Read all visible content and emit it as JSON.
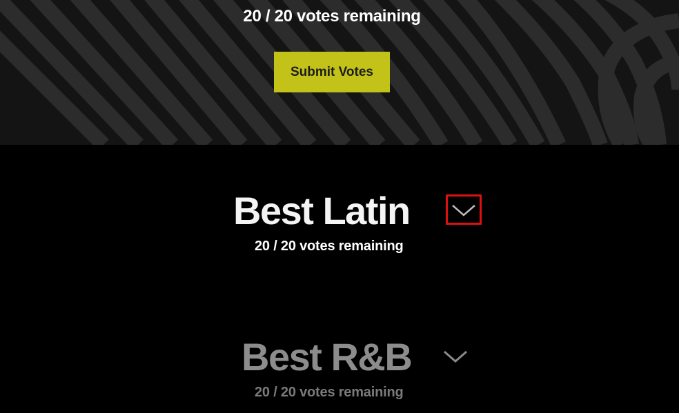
{
  "header": {
    "votes_remaining": "20 / 20 votes remaining",
    "submit_label": "Submit Votes",
    "submit_color": "#c2c219"
  },
  "categories": [
    {
      "title": "Best Latin",
      "votes_remaining": "20 / 20 votes remaining",
      "toggle_icon": "chevron-down-icon",
      "highlighted": true,
      "highlight_color": "#e01010"
    },
    {
      "title": "Best R&B",
      "votes_remaining": "20 / 20 votes remaining",
      "toggle_icon": "chevron-down-icon",
      "dimmed": true
    }
  ]
}
